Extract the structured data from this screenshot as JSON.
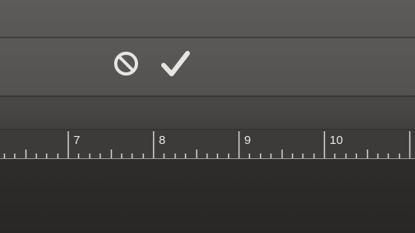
{
  "options_bar": {
    "cancel_icon": "cancel-icon",
    "commit_icon": "checkmark-icon"
  },
  "ruler": {
    "labels": [
      "7",
      "8",
      "9",
      "10"
    ]
  },
  "colors": {
    "panel": "#585755",
    "ruler": "#3c3b39",
    "canvas": "#2c2b29",
    "icon": "#e6e5e2"
  }
}
